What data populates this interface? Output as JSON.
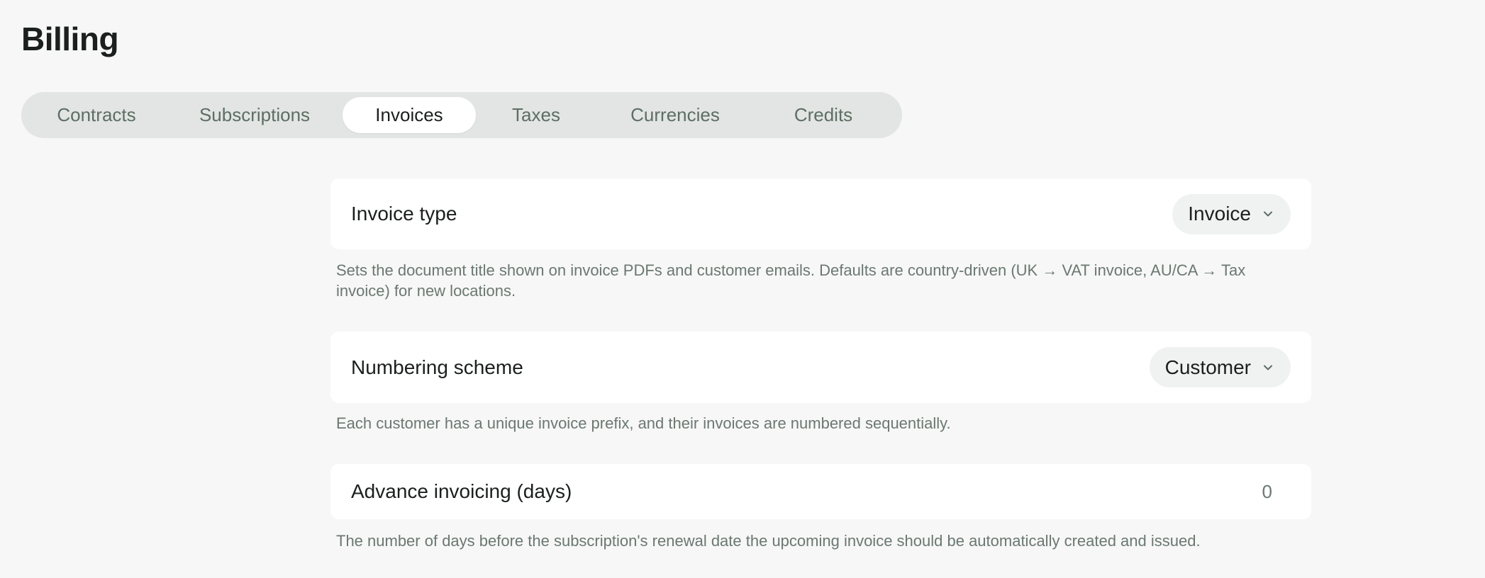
{
  "page": {
    "title": "Billing"
  },
  "tabs": [
    {
      "label": "Contracts",
      "active": false
    },
    {
      "label": "Subscriptions",
      "active": false
    },
    {
      "label": "Invoices",
      "active": true
    },
    {
      "label": "Taxes",
      "active": false
    },
    {
      "label": "Currencies",
      "active": false
    },
    {
      "label": "Credits",
      "active": false
    }
  ],
  "settings": {
    "invoice_type": {
      "label": "Invoice type",
      "value": "Invoice",
      "description": "Sets the document title shown on invoice PDFs and customer emails. Defaults are country-driven (UK → VAT invoice, AU/CA → Tax invoice) for new locations."
    },
    "numbering_scheme": {
      "label": "Numbering scheme",
      "value": "Customer",
      "description": "Each customer has a unique invoice prefix, and their invoices are numbered sequentially."
    },
    "advance_invoicing": {
      "label": "Advance invoicing (days)",
      "value": "0",
      "description": "The number of days before the subscription's renewal date the upcoming invoice should be automatically created and issued."
    }
  },
  "icons": {
    "dropdown": "chevron-down-icon"
  },
  "colors": {
    "background": "#f6f7f6",
    "tab_track": "#e2e5e3",
    "muted_text": "#6b7872",
    "tab_text": "#5d6e64"
  }
}
